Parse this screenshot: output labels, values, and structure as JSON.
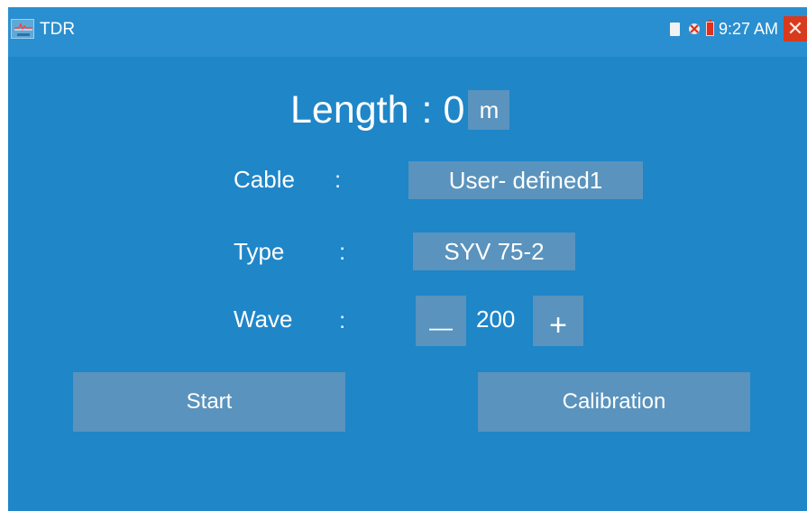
{
  "app": {
    "title": "TDR",
    "icon": "tdr-app-icon"
  },
  "status": {
    "time": "9:27 AM",
    "icons": [
      "sd-card-icon",
      "usb-icon",
      "battery-icon",
      "close-icon"
    ],
    "close_symbol": "✕"
  },
  "length": {
    "label": "Length",
    "separator": ":",
    "value": "0",
    "unit": "m"
  },
  "fields": {
    "cable": {
      "label": "Cable",
      "colon": ":",
      "value": "User- defined1"
    },
    "type": {
      "label": "Type",
      "colon": ":",
      "value": "SYV 75-2"
    },
    "wave": {
      "label": "Wave",
      "colon": ":",
      "minus": "—",
      "value": "200",
      "plus": "+"
    }
  },
  "buttons": {
    "start": "Start",
    "calibration": "Calibration"
  },
  "colors": {
    "background": "#1f86c8",
    "button": "#5a93bd",
    "close": "#d83a1e",
    "battery": "#e0301e"
  }
}
